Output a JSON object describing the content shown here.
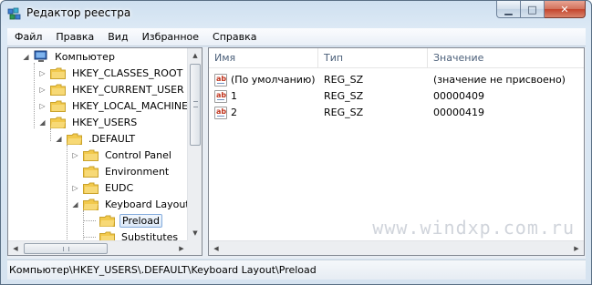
{
  "window": {
    "title": "Редактор реестра",
    "controls": {
      "minimize_glyph": "▁",
      "maximize_glyph": "□",
      "close_glyph": "✕"
    }
  },
  "menubar": {
    "items": [
      "Файл",
      "Правка",
      "Вид",
      "Избранное",
      "Справка"
    ]
  },
  "tree": {
    "root_label": "Компьютер",
    "items": [
      {
        "label": "HKEY_CLASSES_ROOT",
        "expander": "▷"
      },
      {
        "label": "HKEY_CURRENT_USER",
        "expander": "▷"
      },
      {
        "label": "HKEY_LOCAL_MACHINE",
        "expander": "▷"
      },
      {
        "label": "HKEY_USERS",
        "expander": "◢"
      },
      {
        "label": ".DEFAULT",
        "expander": "◢"
      },
      {
        "label": "Control Panel",
        "expander": "▷"
      },
      {
        "label": "Environment",
        "expander": ""
      },
      {
        "label": "EUDC",
        "expander": "▷"
      },
      {
        "label": "Keyboard Layout",
        "expander": "◢"
      },
      {
        "label": "Preload",
        "expander": ""
      },
      {
        "label": "Substitutes",
        "expander": ""
      }
    ],
    "selected": "Preload"
  },
  "list": {
    "columns": [
      "Имя",
      "Тип",
      "Значение"
    ],
    "rows": [
      {
        "name": "(По умолчанию)",
        "type": "REG_SZ",
        "value": "(значение не присвоено)"
      },
      {
        "name": "1",
        "type": "REG_SZ",
        "value": "00000409"
      },
      {
        "name": "2",
        "type": "REG_SZ",
        "value": "00000419"
      }
    ],
    "value_icon_text": "ab"
  },
  "watermark": "www.windxp.com.ru",
  "statusbar": {
    "path": "Компьютер\\HKEY_USERS\\.DEFAULT\\Keyboard Layout\\Preload"
  },
  "colors": {
    "folder": "#f2c94c",
    "selection_border": "#84acdd",
    "header_text": "#4c607a"
  },
  "icons": {
    "app": "regedit-icon",
    "computer": "computer-icon",
    "folder": "folder-icon",
    "string_value": "reg-sz-icon"
  }
}
